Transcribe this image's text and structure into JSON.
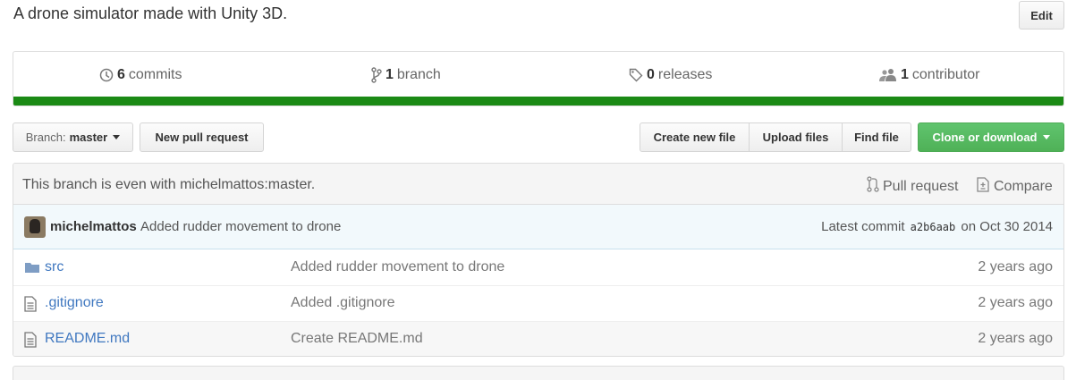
{
  "repo": {
    "description": "A drone simulator made with Unity 3D.",
    "edit_label": "Edit"
  },
  "summary": {
    "commits": {
      "count": "6",
      "label": "commits",
      "icon": "history-icon"
    },
    "branches": {
      "count": "1",
      "label": "branch",
      "icon": "git-branch-icon"
    },
    "releases": {
      "count": "0",
      "label": "releases",
      "icon": "tag-icon"
    },
    "contributors": {
      "count": "1",
      "label": "contributor",
      "icon": "people-icon"
    },
    "language_bar_color": "#1b8a15"
  },
  "toolbar": {
    "branch_prefix": "Branch:",
    "branch_name": "master",
    "new_pr": "New pull request",
    "create_file": "Create new file",
    "upload_files": "Upload files",
    "find_file": "Find file",
    "clone": "Clone or download",
    "clone_color": "#55b760"
  },
  "tracking": {
    "message": "This branch is even with michelmattos:master.",
    "pull_request": "Pull request",
    "compare": "Compare"
  },
  "commit": {
    "author": "michelmattos",
    "message": "Added rudder movement to drone",
    "latest_prefix": "Latest commit",
    "sha": "a2b6aab",
    "date": "on Oct 30 2014"
  },
  "files": [
    {
      "name": "src",
      "type": "directory",
      "message": "Added rudder movement to drone",
      "age": "2 years ago"
    },
    {
      "name": ".gitignore",
      "type": "file",
      "message": "Added .gitignore",
      "age": "2 years ago"
    },
    {
      "name": "README.md",
      "type": "file",
      "message": "Create README.md",
      "age": "2 years ago"
    }
  ]
}
